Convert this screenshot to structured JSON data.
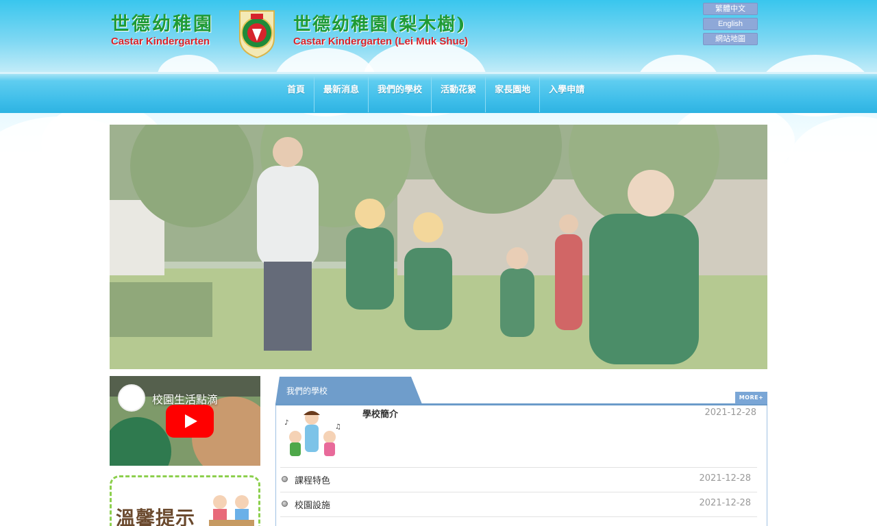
{
  "header": {
    "logo_left_zh": "世德幼稚園",
    "logo_left_en": "Castar Kindergarten",
    "logo_right_zh": "世德幼稚園(梨木樹)",
    "logo_right_en": "Castar Kindergarten (Lei Muk Shue)",
    "crest_icon": "school-crest-icon"
  },
  "lang_links": [
    {
      "label": "繁體中文"
    },
    {
      "label": "English"
    },
    {
      "label": "網站地圖"
    }
  ],
  "nav": [
    {
      "label": "首頁"
    },
    {
      "label": "最新消息"
    },
    {
      "label": "我們的學校"
    },
    {
      "label": "活動花絮"
    },
    {
      "label": "家長園地"
    },
    {
      "label": "入學申請"
    }
  ],
  "video": {
    "title": "校園生活點滴",
    "icon": "youtube-play-icon"
  },
  "reminder": {
    "title": "溫馨提示"
  },
  "school_panel": {
    "tab_label": "我們的學校",
    "more_label": "MORE+",
    "feature": {
      "title": "學校簡介",
      "date": "2021-12-28"
    },
    "items": [
      {
        "title": "課程特色",
        "date": "2021-12-28"
      },
      {
        "title": "校園設施",
        "date": "2021-12-28"
      }
    ]
  },
  "colors": {
    "nav_blue": "#2ab1e0",
    "logo_green": "#1f9a35",
    "logo_red": "#d6242c",
    "panel_blue": "#7aa6d6"
  }
}
